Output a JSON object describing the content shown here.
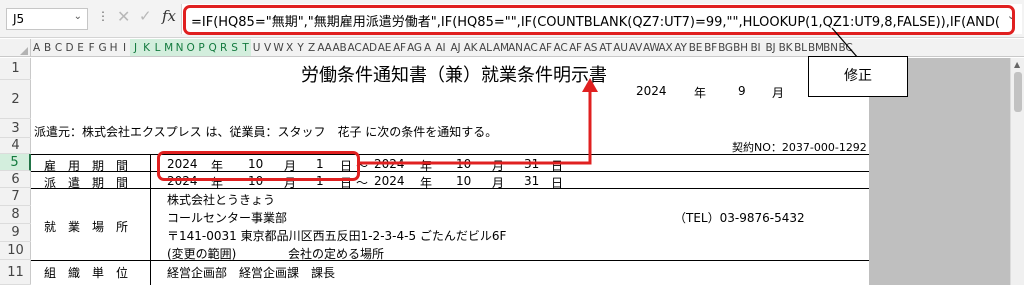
{
  "formula_bar": {
    "name_box": "J5",
    "formula": "=IF(HQ85=\"無期\",\"無期雇用派遣労働者\",IF(HQ85=\"\",IF(COUNTBLANK(QZ7:UT7)=99,\"\",HLOOKUP(1,QZ1:UT9,8,FALSE)),IF(AND("
  },
  "columns": [
    "A",
    "B",
    "C",
    "D",
    "E",
    "F",
    "G",
    "H",
    "I",
    "J",
    "K",
    "L",
    "M",
    "N",
    "O",
    "P",
    "Q",
    "R",
    "S",
    "T",
    "U",
    "V",
    "W",
    "X",
    "Y",
    "Z",
    "AA",
    "AB",
    "AC",
    "AD",
    "AE",
    "AF",
    "AG",
    "A",
    "AI",
    "AJ",
    "AK",
    "AL",
    "AM",
    "AN",
    "AC",
    "AF",
    "AC",
    "AF",
    "AS",
    "AT",
    "AU",
    "AV",
    "AW",
    "AX",
    "AY",
    "BE",
    "BF",
    "BG",
    "BH",
    "BI",
    "BJ",
    "BK",
    "BL",
    "BM",
    "BN",
    "BC"
  ],
  "rows": [
    "1",
    "2",
    "3",
    "4",
    "5",
    "6",
    "7",
    "8",
    "9",
    "10",
    "11"
  ],
  "sheet": {
    "title": "労働条件通知書（兼）就業条件明示書",
    "header_year": "2024",
    "header_year_label": "年",
    "header_month": "9",
    "header_month_label": "月",
    "dispatch_notice": "派遣元：株式会社エクスプレス は、従業員：スタッフ　花子 に次の条件を通知する。",
    "contract_no": "契約NO：2037-000-1292",
    "row5": {
      "label": "雇　用　期　間",
      "year1": "2024",
      "y": "年",
      "month1": "10",
      "m": "月",
      "day1": "1",
      "d": "日",
      "tilde": "～",
      "year2": "2024",
      "month2": "10",
      "day2": "31"
    },
    "row6": {
      "label": "派　遣　期　間",
      "year1": "2024",
      "y": "年",
      "month1": "10",
      "m": "月",
      "day1": "1",
      "d": "日",
      "tilde": "～",
      "year2": "2024",
      "month2": "10",
      "day2": "31"
    },
    "work_place": {
      "label": "就　業　場　所",
      "company": "株式会社とうきょう",
      "dept": "コールセンター事業部",
      "tel": "（TEL）03-9876-5432",
      "address": "〒141-0031  東京都品川区西五反田1-2-3-4-5  ごたんだビル6F",
      "scope_label": "(変更の範囲)",
      "scope_value": "会社の定める場所"
    },
    "org_unit": {
      "label": "組　織　単　位",
      "value": "経営企画部　経営企画課　課長"
    }
  },
  "annotation": {
    "callout_text": "修正"
  }
}
